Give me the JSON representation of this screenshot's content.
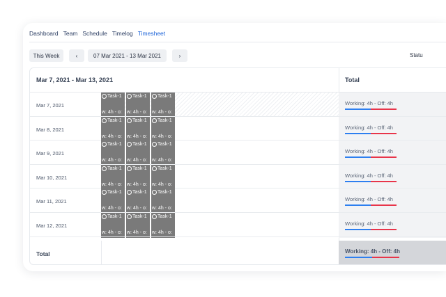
{
  "nav": {
    "items": [
      {
        "label": "Dashboard",
        "active": false
      },
      {
        "label": "Team",
        "active": false
      },
      {
        "label": "Schedule",
        "active": false
      },
      {
        "label": "Timelog",
        "active": false
      },
      {
        "label": "Timesheet",
        "active": true
      }
    ]
  },
  "toolbar": {
    "this_week_label": "This Week",
    "prev_icon": "‹",
    "range_label": "07 Mar 2021 - 13 Mar 2021",
    "next_icon": "›",
    "status_label": "Statu"
  },
  "table": {
    "header_range": "Mar 7, 2021 - Mar 13, 2021",
    "header_total": "Total",
    "rows": [
      {
        "date": "Mar 7, 2021",
        "tasks": [
          {
            "name": "Task-1",
            "work": "w: 4h - o:"
          },
          {
            "name": "Task-1",
            "work": "w: 4h - o:"
          },
          {
            "name": "Task-1",
            "work": "w: 4h - o:"
          }
        ],
        "total": "Working: 4h - Off: 4h",
        "working_fraction": 0.5
      },
      {
        "date": "Mar 8, 2021",
        "tasks": [
          {
            "name": "Task-1",
            "work": "w: 4h - o:"
          },
          {
            "name": "Task-1",
            "work": "w: 4h - o:"
          },
          {
            "name": "Task-1",
            "work": "w: 4h - o:"
          }
        ],
        "total": "Working: 4h - Off: 4h",
        "working_fraction": 0.5
      },
      {
        "date": "Mar 9, 2021",
        "tasks": [
          {
            "name": "Task-1",
            "work": "w: 4h - o:"
          },
          {
            "name": "Task-1",
            "work": "w: 4h - o:"
          },
          {
            "name": "Task-1",
            "work": "w: 4h - o:"
          }
        ],
        "total": "Working: 4h - Off: 4h",
        "working_fraction": 0.5
      },
      {
        "date": "Mar 10, 2021",
        "tasks": [
          {
            "name": "Task-1",
            "work": "w: 4h - o:"
          },
          {
            "name": "Task-1",
            "work": "w: 4h - o:"
          },
          {
            "name": "Task-1",
            "work": "w: 4h - o:"
          }
        ],
        "total": "Working: 4h - Off: 4h",
        "working_fraction": 0.5
      },
      {
        "date": "Mar 11, 2021",
        "tasks": [
          {
            "name": "Task-1",
            "work": "w: 4h - o:"
          },
          {
            "name": "Task-1",
            "work": "w: 4h - o:"
          },
          {
            "name": "Task-1",
            "work": "w: 4h - o:"
          }
        ],
        "total": "Working: 4h - Off: 4h",
        "working_fraction": 0.5
      },
      {
        "date": "Mar 12, 2021",
        "tasks": [
          {
            "name": "Task-1",
            "work": "w: 4h - o:"
          },
          {
            "name": "Task-1",
            "work": "w: 4h - o:"
          },
          {
            "name": "Task-1",
            "work": "w: 4h - o:"
          }
        ],
        "total": "Working: 4h - Off: 4h",
        "working_fraction": 0.5
      },
      {
        "date": "",
        "tasks": [
          {
            "name": "Task-1",
            "work": "w: 4h - o:"
          },
          {
            "name": "Task-1",
            "work": "w: 4h - o:"
          },
          {
            "name": "Task-1",
            "work": "w: 4h - o:"
          }
        ],
        "total": "",
        "working_fraction": 0.5
      }
    ],
    "footer_label": "Total",
    "footer_total": "Working: 4h - Off: 4h",
    "footer_working_fraction": 0.5
  },
  "colors": {
    "accent": "#1d64d8",
    "working": "#2d7ff0",
    "off": "#e8354a",
    "task_block": "#7a7a7a"
  }
}
